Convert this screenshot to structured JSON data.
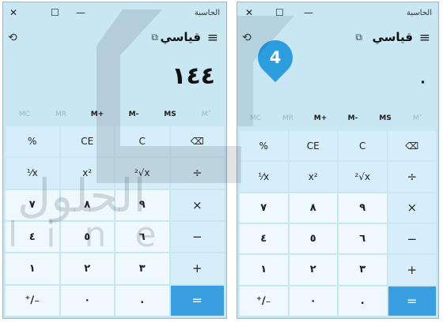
{
  "calc_left": {
    "window_title": "الحاسبة",
    "mode": "قياسي",
    "display": "١٤٤",
    "memory": [
      "MC",
      "MR",
      "M+",
      "M-",
      "MS",
      "M˅"
    ],
    "keys": [
      "%",
      "CE",
      "C",
      "⌫",
      "⅟x",
      "x²",
      "²√x",
      "÷",
      "٧",
      "٨",
      "٩",
      "×",
      "٤",
      "٥",
      "٦",
      "−",
      "١",
      "٢",
      "٣",
      "+",
      "⁺∕₋",
      "٠",
      ".",
      "="
    ]
  },
  "calc_right": {
    "window_title": "الحاسبة",
    "mode": "قياسي",
    "display": "٠",
    "step_badge": "4",
    "memory": [
      "MC",
      "MR",
      "M+",
      "M-",
      "MS",
      "M˅"
    ],
    "keys": [
      "%",
      "CE",
      "C",
      "⌫",
      "⅟x",
      "x²",
      "²√x",
      "÷",
      "٧",
      "٨",
      "٩",
      "×",
      "٤",
      "٥",
      "٦",
      "−",
      "١",
      "٢",
      "٣",
      "+",
      "⁺∕₋",
      "٠",
      ".",
      "="
    ]
  },
  "watermark": {
    "text": "الحلول",
    "subtext": "line"
  },
  "colors": {
    "window_bg": "#c9e6f3",
    "key_bg": "#d5eef9",
    "num_key_bg": "#eef8fd",
    "equals_bg": "#3a9fe0",
    "badge_bg": "#2c9ee0"
  }
}
